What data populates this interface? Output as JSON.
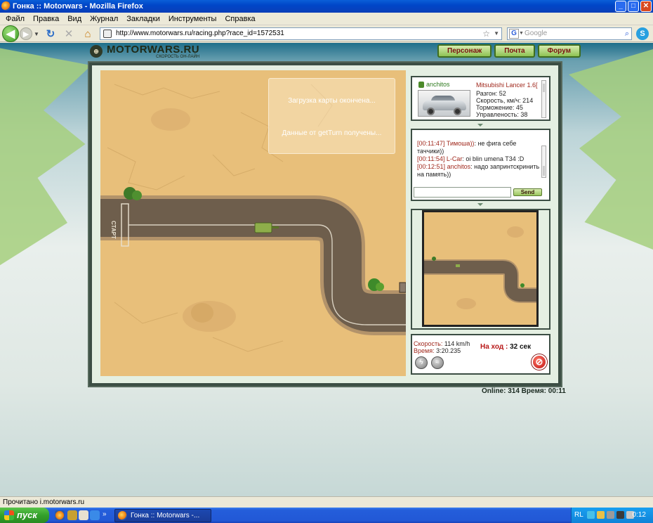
{
  "window": {
    "title": "Гонка :: Motorwars - Mozilla Firefox",
    "min": "_",
    "max": "□",
    "close": "✕"
  },
  "menu": [
    "Файл",
    "Правка",
    "Вид",
    "Журнал",
    "Закладки",
    "Инструменты",
    "Справка"
  ],
  "nav": {
    "back_icon": "◀",
    "forward_icon": "▶",
    "history_icon": "▼",
    "reload_icon": "↻",
    "stop_icon": "✕",
    "home_icon": "⌂",
    "url": "http://www.motorwars.ru/racing.php?race_id=1572531",
    "search_placeholder": "Google",
    "search_engine_letter": "G"
  },
  "site": {
    "logo_text": "MOTORWARS.RU",
    "logo_tagline": "СКОРОСТЬ ОН-ЛАЙН",
    "nav_buttons": [
      "Персонаж",
      "Почта",
      "Форум"
    ]
  },
  "map": {
    "start_label": "СТАРТ",
    "loading_line1": "Загрузка карты окончена...",
    "loading_line2": "Данные от getTurn получены..."
  },
  "car": {
    "user": "anchitos",
    "model": "Mitsubishi Lancer 1.6[",
    "stats": [
      "Разгон: 52",
      "Скорость, км/ч: 214",
      "Торможение: 45",
      "Управленость: 38"
    ]
  },
  "chat": {
    "messages": [
      {
        "ts": "[00:11:47]",
        "nick": "Тимоша))",
        "text": ": не фига себе таччики))"
      },
      {
        "ts": "[00:11:54]",
        "nick": "L-Car",
        "text": ": oi blin umena T34 :D"
      },
      {
        "ts": "[00:12:51]",
        "nick": "anchitos",
        "text": ": надо запринтскринить на память))"
      }
    ],
    "input_value": "",
    "send_label": "Send"
  },
  "race": {
    "speed_label": "Скорость:",
    "speed_value": "114 km/h",
    "time_label": "Время:",
    "time_value": "3:20.235",
    "turn_label": "На ход :",
    "turn_value": "32 сек"
  },
  "footer": {
    "online": "Online: 314  Время: 00:11"
  },
  "status": "Прочитано i.motorwars.ru",
  "taskbar": {
    "start": "пуск",
    "task": "Гонка :: Motorwars -...",
    "lang": "RL",
    "clock": "0:12"
  },
  "colors": {
    "accent_green": "#8ec253",
    "nav_text": "#7a1010",
    "sand": "#e8bf7a",
    "road": "#6e5e4c"
  }
}
